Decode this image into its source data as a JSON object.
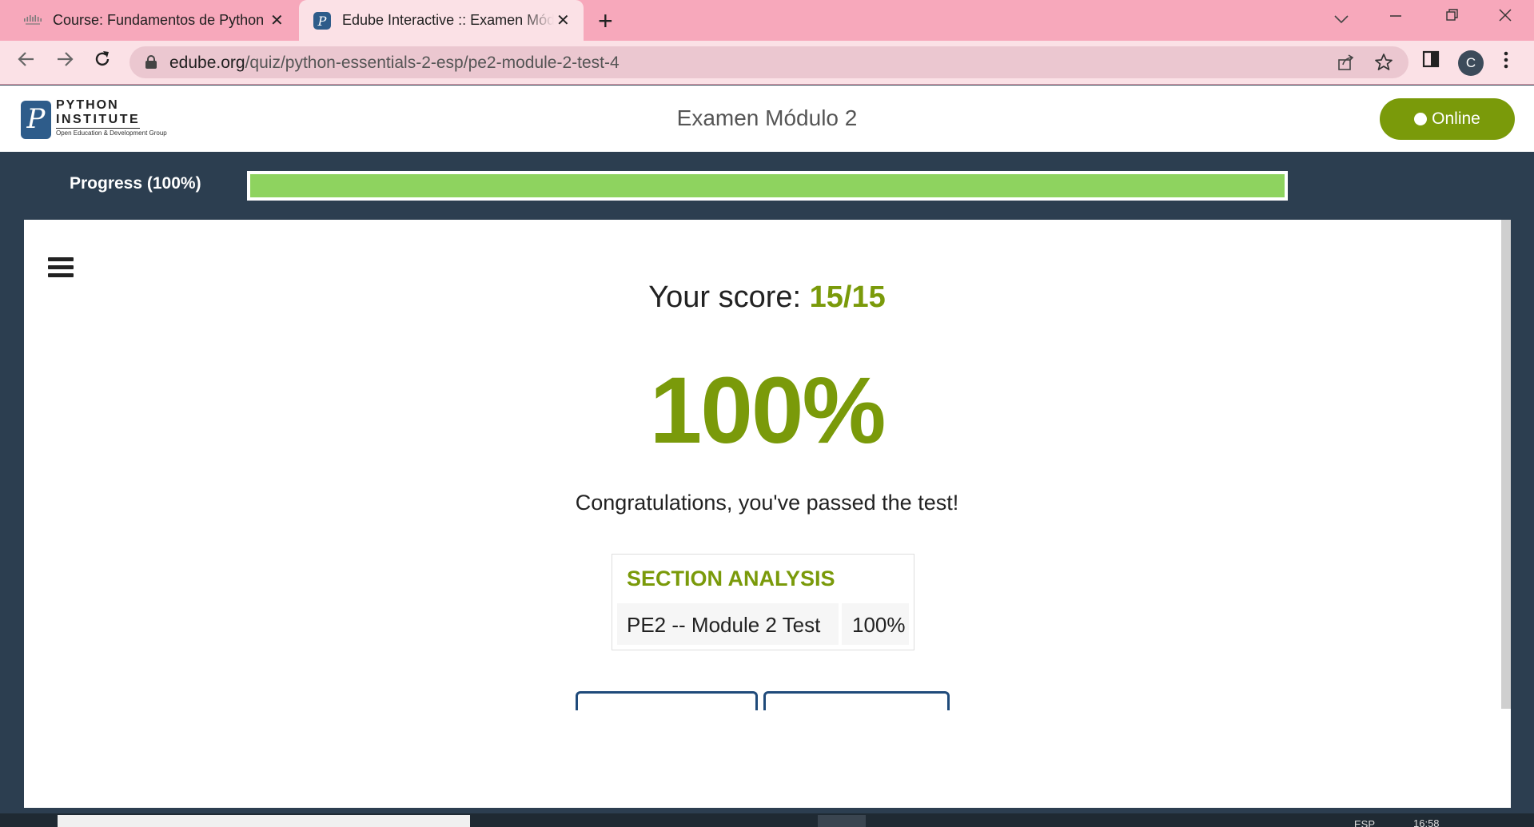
{
  "browser": {
    "tabs": [
      {
        "title": "Course: Fundamentos de Python",
        "icon": "cisco-icon",
        "active": false
      },
      {
        "title": "Edube Interactive :: Examen Módulo 2",
        "icon": "python-institute-icon",
        "active": true
      }
    ],
    "new_tab": "+",
    "url_domain": "edube.org",
    "url_path": "/quiz/python-essentials-2-esp/pe2-module-2-test-4",
    "profile_initial": "C",
    "colors": {
      "tabstrip": "#f7a8bb",
      "toolbar": "#fbe1e6",
      "omnibox": "#ebc7d0"
    }
  },
  "header": {
    "logo_line1": "PYTHON",
    "logo_line2": "INSTITUTE",
    "logo_tagline": "Open Education & Development Group",
    "title": "Examen Módulo 2",
    "status_button": "Online"
  },
  "progress": {
    "label": "Progress (100%)",
    "value": 1.0,
    "fill_color": "#8ed35f"
  },
  "result": {
    "score_label": "Your score:",
    "score_value": "15/15",
    "percent": "100%",
    "message": "Congratulations, you've passed the test!",
    "accent_color": "#7a9a0a"
  },
  "section_analysis": {
    "heading": "SECTION ANALYSIS",
    "rows": [
      {
        "name": "PE2 -- Module 2 Test",
        "value": "100%"
      }
    ]
  },
  "taskbar": {
    "language": "ESP",
    "time": "16:58"
  }
}
